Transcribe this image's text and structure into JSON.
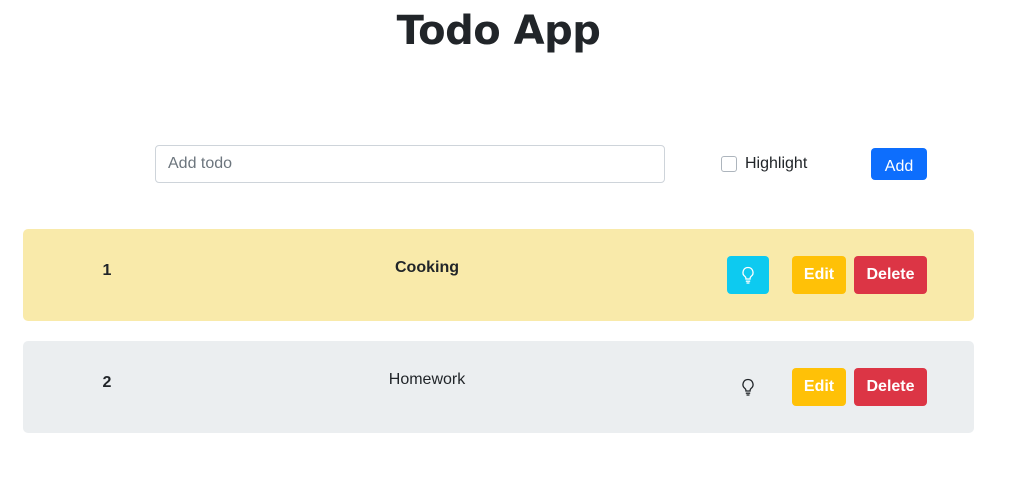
{
  "app": {
    "title": "Todo App"
  },
  "form": {
    "input_placeholder": "Add todo",
    "input_value": "",
    "highlight_label": "Highlight",
    "highlight_checked": false,
    "add_label": "Add",
    "add_color": "#0d6efd"
  },
  "todos": [
    {
      "number": "1",
      "text": "Cooking",
      "highlighted": true,
      "bg": "#f9eaaa",
      "bulb_bg": "#0dcaf0",
      "icon": "lightbulb-icon",
      "edit_label": "Edit",
      "delete_label": "Delete"
    },
    {
      "number": "2",
      "text": "Homework",
      "highlighted": false,
      "bg": "#ebeef0",
      "icon": "lightbulb-icon",
      "edit_label": "Edit",
      "delete_label": "Delete"
    }
  ],
  "colors": {
    "edit": "#ffc107",
    "delete": "#dc3545"
  }
}
